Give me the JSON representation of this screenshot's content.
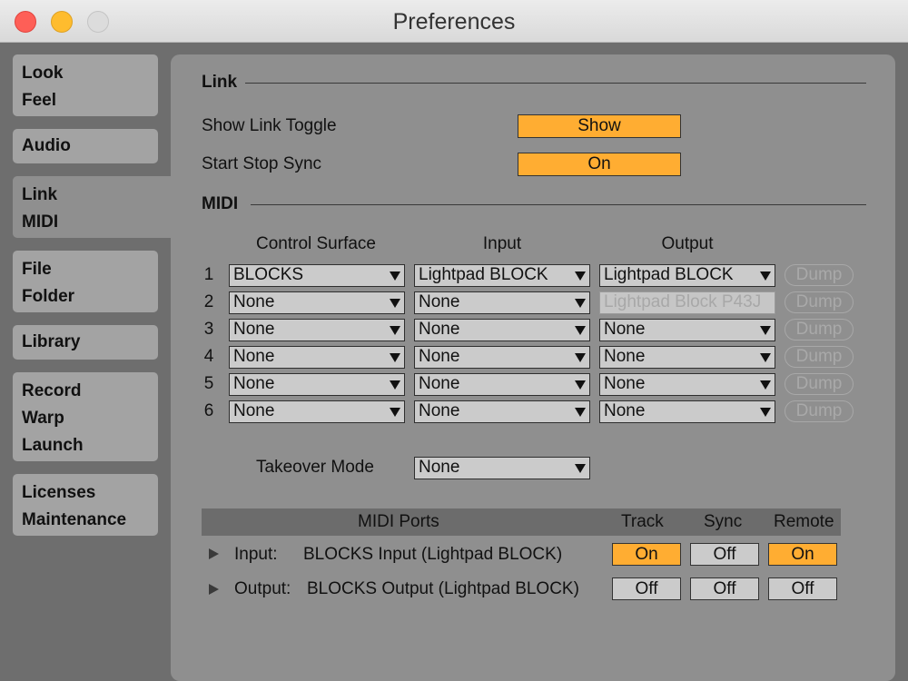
{
  "window": {
    "title": "Preferences"
  },
  "sidebar": {
    "tabs": [
      {
        "lines": [
          "Look",
          "Feel"
        ]
      },
      {
        "lines": [
          "Audio"
        ]
      },
      {
        "lines": [
          "Link",
          "MIDI"
        ],
        "active": true
      },
      {
        "lines": [
          "File",
          "Folder"
        ]
      },
      {
        "lines": [
          "Library"
        ]
      },
      {
        "lines": [
          "Record",
          "Warp",
          "Launch"
        ]
      },
      {
        "lines": [
          "Licenses",
          "Maintenance"
        ]
      }
    ]
  },
  "link": {
    "section_title": "Link",
    "show_link_toggle": {
      "label": "Show Link Toggle",
      "value": "Show"
    },
    "start_stop_sync": {
      "label": "Start Stop Sync",
      "value": "On"
    }
  },
  "midi": {
    "section_title": "MIDI",
    "columns": {
      "control_surface": "Control Surface",
      "input": "Input",
      "output": "Output"
    },
    "rows": [
      {
        "num": "1",
        "surface": "BLOCKS",
        "input": "Lightpad BLOCK",
        "output": "Lightpad BLOCK",
        "dump": "Dump"
      },
      {
        "num": "2",
        "surface": "None",
        "input": "None",
        "output": "Lightpad Block P43J",
        "dump": "Dump"
      },
      {
        "num": "3",
        "surface": "None",
        "input": "None",
        "output": "None",
        "dump": "Dump"
      },
      {
        "num": "4",
        "surface": "None",
        "input": "None",
        "output": "None",
        "dump": "Dump"
      },
      {
        "num": "5",
        "surface": "None",
        "input": "None",
        "output": "None",
        "dump": "Dump"
      },
      {
        "num": "6",
        "surface": "None",
        "input": "None",
        "output": "None",
        "dump": "Dump"
      }
    ],
    "takeover_mode": {
      "label": "Takeover Mode",
      "value": "None"
    }
  },
  "midi_ports": {
    "headers": {
      "ports": "MIDI Ports",
      "track": "Track",
      "sync": "Sync",
      "remote": "Remote"
    },
    "rows": [
      {
        "direction": "Input:",
        "name": "BLOCKS Input (Lightpad BLOCK)",
        "track": "On",
        "sync": "Off",
        "remote": "On"
      },
      {
        "direction": "Output:",
        "name": "BLOCKS Output (Lightpad BLOCK)",
        "track": "Off",
        "sync": "Off",
        "remote": "Off"
      }
    ]
  },
  "colors": {
    "accent": "#ffad32",
    "panel": "#8f8f8f",
    "background": "#6e6e6e"
  }
}
